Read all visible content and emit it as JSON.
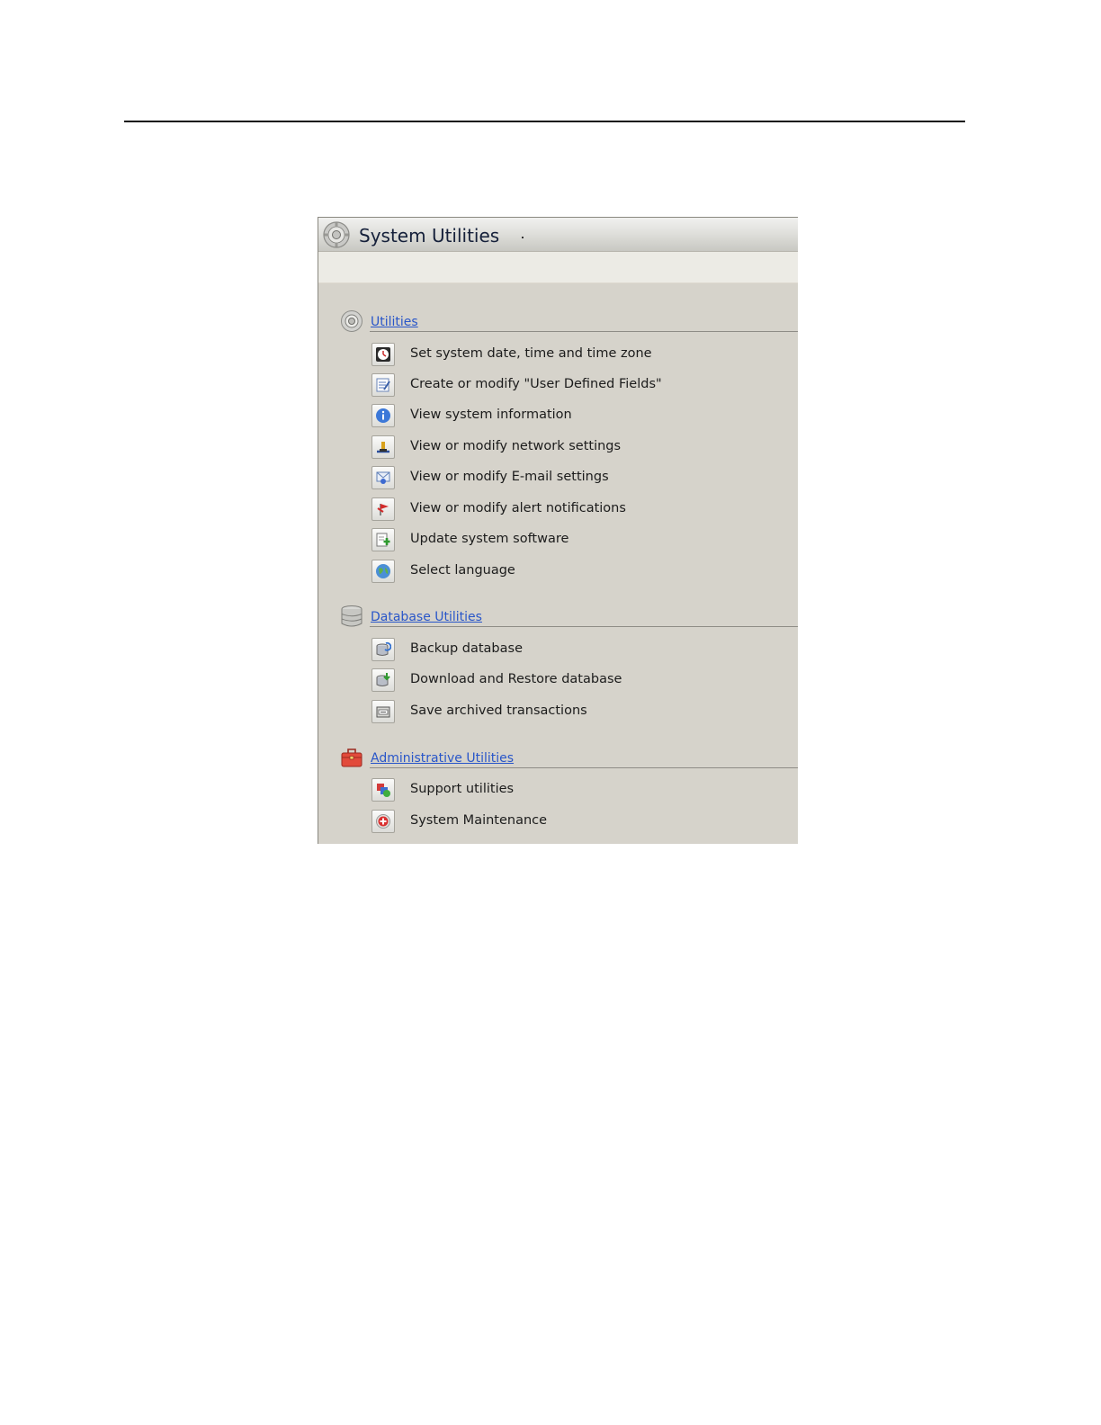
{
  "window": {
    "title": "System Utilities"
  },
  "sections": [
    {
      "label": "Utilities",
      "icon": "gear-icon",
      "items": [
        {
          "label": "Set system date, time and time zone",
          "icon": "clock-icon"
        },
        {
          "label": "Create or modify \"User Defined Fields\"",
          "icon": "edit-form-icon"
        },
        {
          "label": "View system information",
          "icon": "info-icon"
        },
        {
          "label": "View or modify network settings",
          "icon": "network-icon"
        },
        {
          "label": "View or modify E-mail settings",
          "icon": "email-icon"
        },
        {
          "label": "View or modify alert notifications",
          "icon": "alert-flag-icon"
        },
        {
          "label": "Update system software",
          "icon": "software-update-icon"
        },
        {
          "label": "Select language",
          "icon": "globe-icon"
        }
      ]
    },
    {
      "label": "Database Utilities",
      "icon": "database-icon",
      "items": [
        {
          "label": "Backup database",
          "icon": "database-backup-icon"
        },
        {
          "label": "Download and Restore database",
          "icon": "database-restore-icon"
        },
        {
          "label": "Save archived transactions",
          "icon": "archive-icon"
        }
      ]
    },
    {
      "label": "Administrative Utilities",
      "icon": "toolbox-icon",
      "items": [
        {
          "label": "Support utilities",
          "icon": "support-tools-icon"
        },
        {
          "label": "System Maintenance",
          "icon": "maintenance-icon"
        }
      ]
    }
  ],
  "colors": {
    "link": "#2956c9",
    "panel_bg": "#d6d3cb",
    "toolbar_bg": "#ecebe5"
  }
}
